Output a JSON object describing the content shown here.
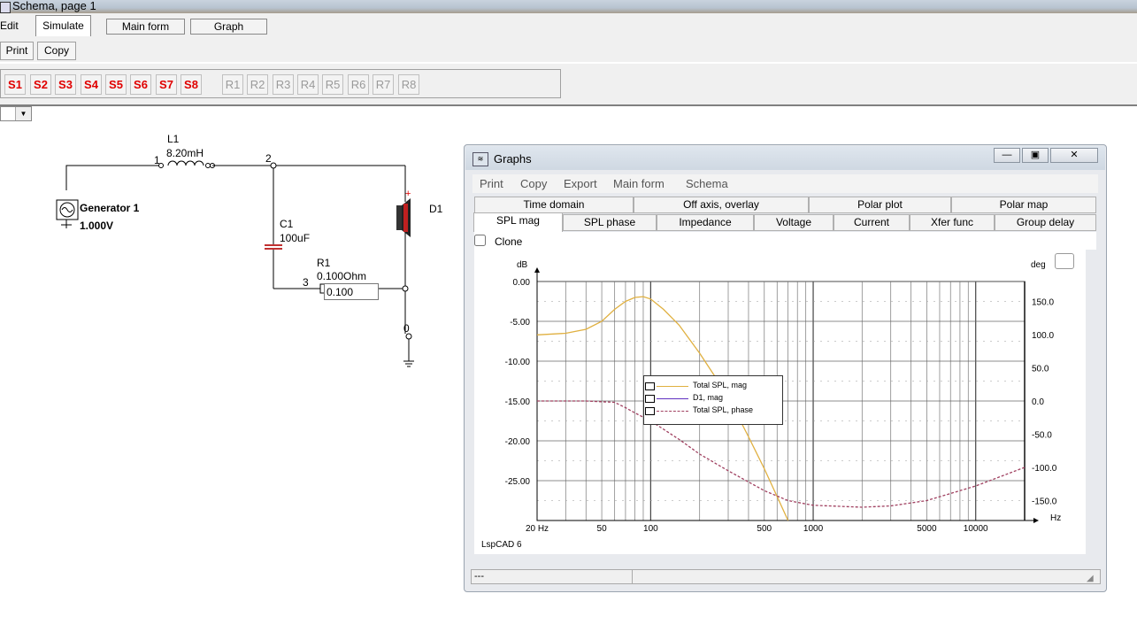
{
  "window": {
    "title": "Schema, page 1"
  },
  "menu": {
    "edit": "Edit",
    "simulate": "Simulate",
    "main_form": "Main form",
    "graph": "Graph"
  },
  "toolbar": {
    "print": "Print",
    "copy": "Copy"
  },
  "s_buttons": [
    "S1",
    "S2",
    "S3",
    "S4",
    "S5",
    "S6",
    "S7",
    "S8"
  ],
  "r_buttons": [
    "R1",
    "R2",
    "R3",
    "R4",
    "R5",
    "R6",
    "R7",
    "R8"
  ],
  "schematic": {
    "l1_name": "L1",
    "l1_value": "8.20mH",
    "gen_name": "Generator 1",
    "gen_value": "1.000V",
    "c1_name": "C1",
    "c1_value": "100uF",
    "r1_name": "R1",
    "r1_value": "0.100Ohm",
    "r1_edit": "0.100",
    "d1_name": "D1",
    "node1": "1",
    "node2": "2",
    "node3": "3",
    "node0": "0"
  },
  "graphs": {
    "title": "Graphs",
    "menu": [
      "Print",
      "Copy",
      "Export",
      "Main form",
      "Schema"
    ],
    "tabs_row1": [
      "Time domain",
      "Off axis, overlay",
      "Polar plot",
      "Polar map"
    ],
    "tabs_row2": [
      "SPL mag",
      "SPL phase",
      "Impedance",
      "Voltage",
      "Current",
      "Xfer func",
      "Group delay"
    ],
    "clone_label": "Clone",
    "status": "---",
    "watermark": "LspCAD 6"
  },
  "chart_data": {
    "type": "line",
    "ylabel": "dB",
    "y2label": "deg",
    "xlabel": "Hz",
    "x_scale": "log",
    "xlim": [
      20,
      20000
    ],
    "ylim": [
      -30,
      0
    ],
    "y2lim": [
      -180,
      180
    ],
    "y_ticks": [
      "0.00",
      "-5.00",
      "-10.00",
      "-15.00",
      "-20.00",
      "-25.00"
    ],
    "y2_ticks": [
      "150.0",
      "100.0",
      "50.0",
      "0.0",
      "-50.0",
      "-100.0",
      "-150.0"
    ],
    "x_ticks": [
      "20 Hz",
      "50",
      "100",
      "500",
      "1000",
      "5000",
      "10000"
    ],
    "x_tick_values": [
      20,
      50,
      100,
      500,
      1000,
      5000,
      10000
    ],
    "legend": [
      "Total SPL, mag",
      "D1, mag",
      "Total SPL, phase"
    ],
    "series": [
      {
        "name": "Total SPL, mag",
        "axis": "left",
        "color": "#e0b040",
        "x": [
          20,
          30,
          40,
          50,
          60,
          70,
          80,
          90,
          100,
          120,
          150,
          200,
          250,
          300,
          400,
          500,
          600,
          700
        ],
        "y": [
          -6.7,
          -6.5,
          -6.0,
          -5.0,
          -3.5,
          -2.5,
          -2.0,
          -1.9,
          -2.2,
          -3.5,
          -5.5,
          -9.0,
          -12.0,
          -14.5,
          -19.5,
          -23.5,
          -27.0,
          -30.0
        ]
      },
      {
        "name": "D1, mag",
        "axis": "left",
        "color": "#6030c0",
        "x": [],
        "y": []
      },
      {
        "name": "Total SPL, phase",
        "axis": "right",
        "color": "#a04060",
        "x": [
          20,
          40,
          60,
          70,
          80,
          100,
          150,
          200,
          300,
          500,
          700,
          1000,
          2000,
          3000,
          5000,
          10000,
          20000
        ],
        "y": [
          0,
          0,
          -2,
          -10,
          -18,
          -30,
          -58,
          -80,
          -105,
          -135,
          -150,
          -157,
          -160,
          -158,
          -150,
          -128,
          -100
        ]
      }
    ]
  }
}
